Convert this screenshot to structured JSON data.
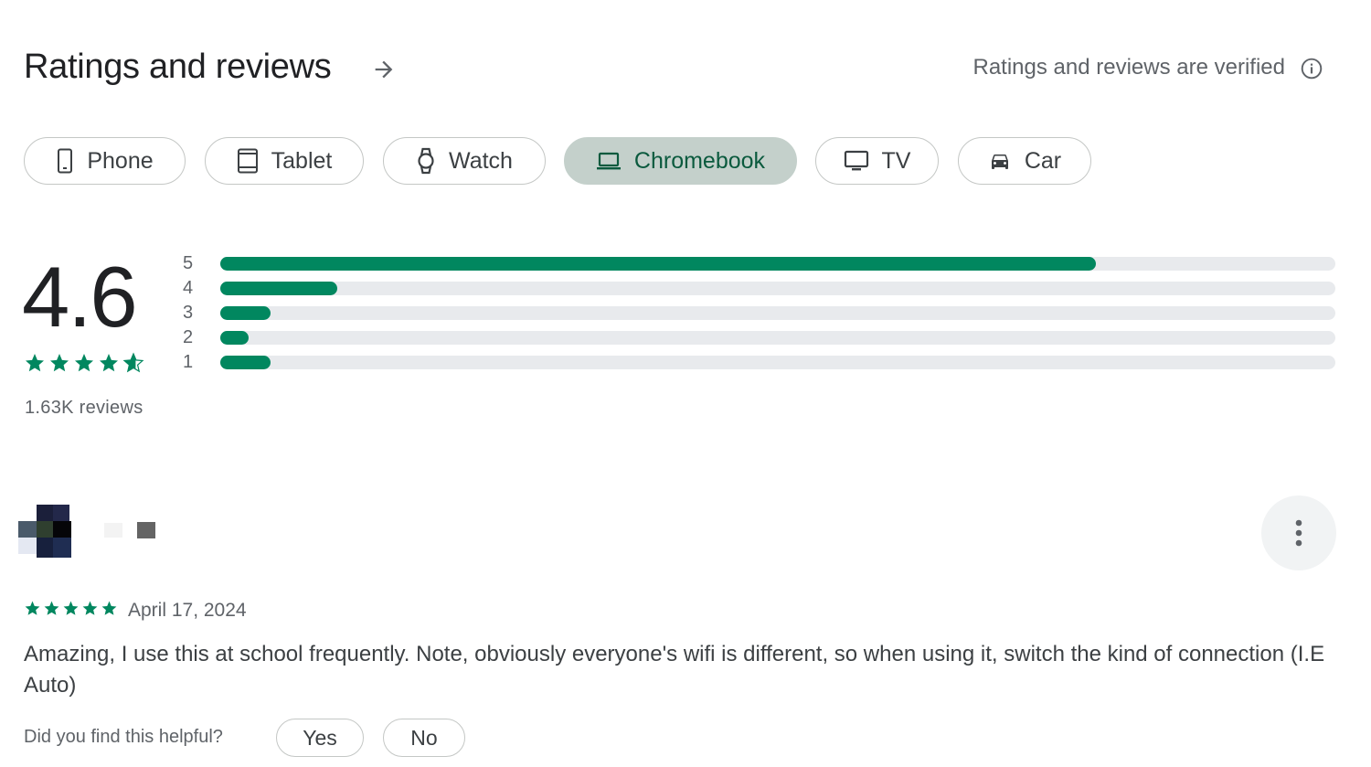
{
  "header": {
    "title": "Ratings and reviews",
    "verified_text": "Ratings and reviews are verified"
  },
  "device_chips": [
    {
      "label": "Phone",
      "icon": "phone-icon",
      "selected": false
    },
    {
      "label": "Tablet",
      "icon": "tablet-icon",
      "selected": false
    },
    {
      "label": "Watch",
      "icon": "watch-icon",
      "selected": false
    },
    {
      "label": "Chromebook",
      "icon": "laptop-icon",
      "selected": true
    },
    {
      "label": "TV",
      "icon": "tv-icon",
      "selected": false
    },
    {
      "label": "Car",
      "icon": "car-icon",
      "selected": false
    }
  ],
  "summary": {
    "rating": "4.6",
    "stars": 4.6,
    "review_count": "1.63K reviews",
    "distribution": [
      {
        "star": "5",
        "fraction": 0.785
      },
      {
        "star": "4",
        "fraction": 0.105
      },
      {
        "star": "3",
        "fraction": 0.045
      },
      {
        "star": "2",
        "fraction": 0.025
      },
      {
        "star": "1",
        "fraction": 0.045
      }
    ]
  },
  "review": {
    "stars": 5,
    "date": "April 17, 2024",
    "text": "Amazing, I use this at school frequently. Note, obviously everyone's wifi is different, so when using it, switch the kind of connection (I.E Auto)",
    "helpful_question": "Did you find this helpful?",
    "yes_label": "Yes",
    "no_label": "No"
  },
  "colors": {
    "accent": "#01875f",
    "chip_selected_bg": "#c4d0cb",
    "track": "#e8eaed"
  }
}
